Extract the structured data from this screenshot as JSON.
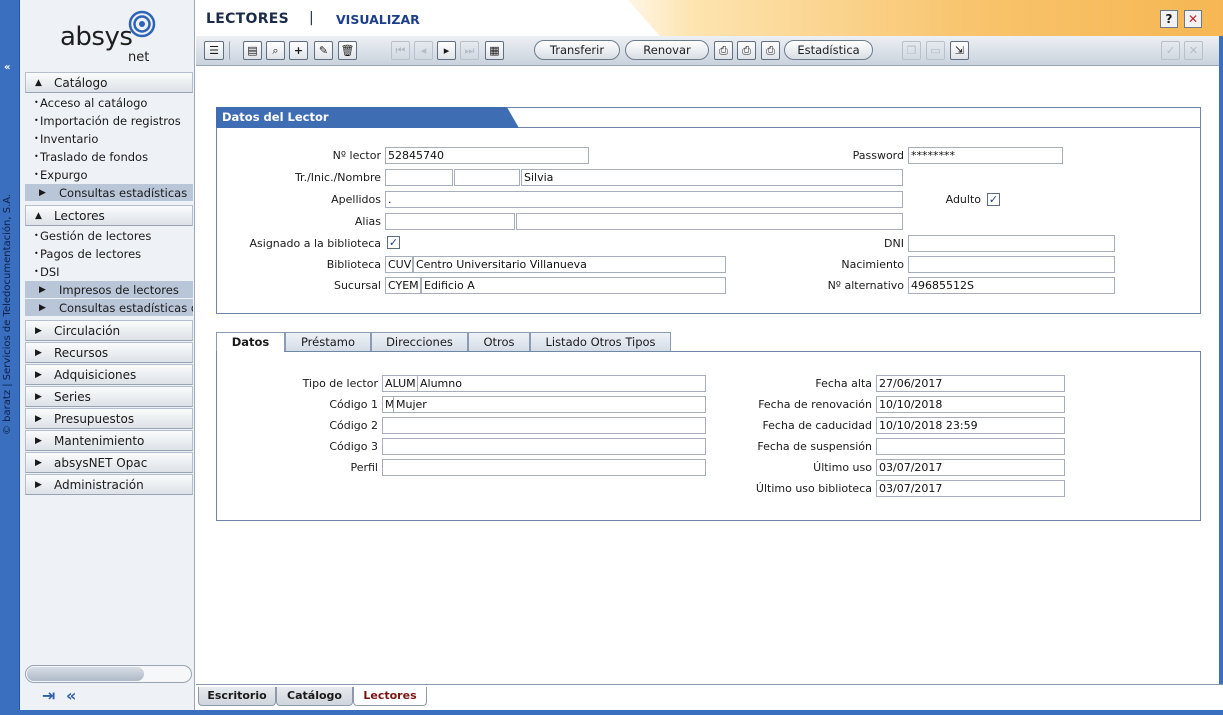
{
  "strip": {
    "collapse": "«",
    "copyright": "© baratz | Servicios de Teledocumentación, S.A."
  },
  "logo": {
    "brand": "absys",
    "sub": "net"
  },
  "menu": {
    "catalogo": "Catálogo",
    "catalogo_items": [
      "Acceso al catálogo",
      "Importación de registros",
      "Inventario",
      "Traslado de fondos",
      "Expurgo"
    ],
    "catalogo_sub": "Consultas estadísticas",
    "lectores": "Lectores",
    "lectores_items": [
      "Gestión de lectores",
      "Pagos de lectores",
      "DSI"
    ],
    "lectores_sub": [
      "Impresos de lectores",
      "Consultas estadísticas de"
    ],
    "others": [
      "Circulación",
      "Recursos",
      "Adquisiciones",
      "Series",
      "Presupuestos",
      "Mantenimiento",
      "absysNET Opac",
      "Administración"
    ]
  },
  "sidebar_icons": {
    "home": "⇥",
    "back": "«"
  },
  "header": {
    "title": "LECTORES",
    "sep": "|",
    "mode": "VISUALIZAR",
    "help": "?",
    "close": "✕"
  },
  "toolbar": {
    "transferir": "Transferir",
    "renovar": "Renovar",
    "estadistica": "Estadística"
  },
  "lector": {
    "section_title": "Datos del Lector",
    "num_lector_label": "Nº lector",
    "num_lector": "52845740",
    "password_label": "Password",
    "password": "********",
    "trato_label": "Tr./Inic./Nombre",
    "trato": "",
    "iniciales": "",
    "nombre": "Silvia",
    "apellidos_label": "Apellidos",
    "apellidos": ".",
    "adulto_label": "Adulto",
    "adulto": "✓",
    "alias_label": "Alias",
    "alias": "",
    "alias2": "",
    "asignado_label": "Asignado a la biblioteca",
    "asignado": "✓",
    "dni_label": "DNI",
    "dni": "",
    "biblioteca_label": "Biblioteca",
    "biblioteca_code": "CUV",
    "biblioteca_name": "Centro Universitario Villanueva",
    "nacimiento_label": "Nacimiento",
    "nacimiento": "",
    "sucursal_label": "Sucursal",
    "sucursal_code": "CYEM",
    "sucursal_name": "Edificio A",
    "num_alt_label": "Nº alternativo",
    "num_alt": "49685512S"
  },
  "tabs": [
    "Datos",
    "Préstamo",
    "Direcciones",
    "Otros",
    "Listado Otros Tipos"
  ],
  "datos": {
    "tipo_label": "Tipo de lector",
    "tipo_code": "ALUM",
    "tipo_name": "Alumno",
    "codigo1_label": "Código 1",
    "codigo1_code": "M",
    "codigo1_name": "Mujer",
    "codigo2_label": "Código 2",
    "codigo2": "",
    "codigo3_label": "Código 3",
    "codigo3": "",
    "perfil_label": "Perfil",
    "perfil": "",
    "fecha_alta_label": "Fecha alta",
    "fecha_alta": "27/06/2017",
    "fecha_renov_label": "Fecha de renovación",
    "fecha_renov": "10/10/2018",
    "fecha_cad_label": "Fecha de caducidad",
    "fecha_cad": "10/10/2018 23:59",
    "fecha_susp_label": "Fecha de suspensión",
    "fecha_susp": "",
    "ultimo_uso_label": "Último uso",
    "ultimo_uso": "03/07/2017",
    "ultimo_uso_bib_label": "Último uso biblioteca",
    "ultimo_uso_bib": "03/07/2017"
  },
  "bottom_tabs": [
    "Escritorio",
    "Catálogo",
    "Lectores"
  ],
  "colors": {
    "accent": "#3a6fc0",
    "section_header": "#3f6db3",
    "active_tab_text": "#7a1414"
  }
}
